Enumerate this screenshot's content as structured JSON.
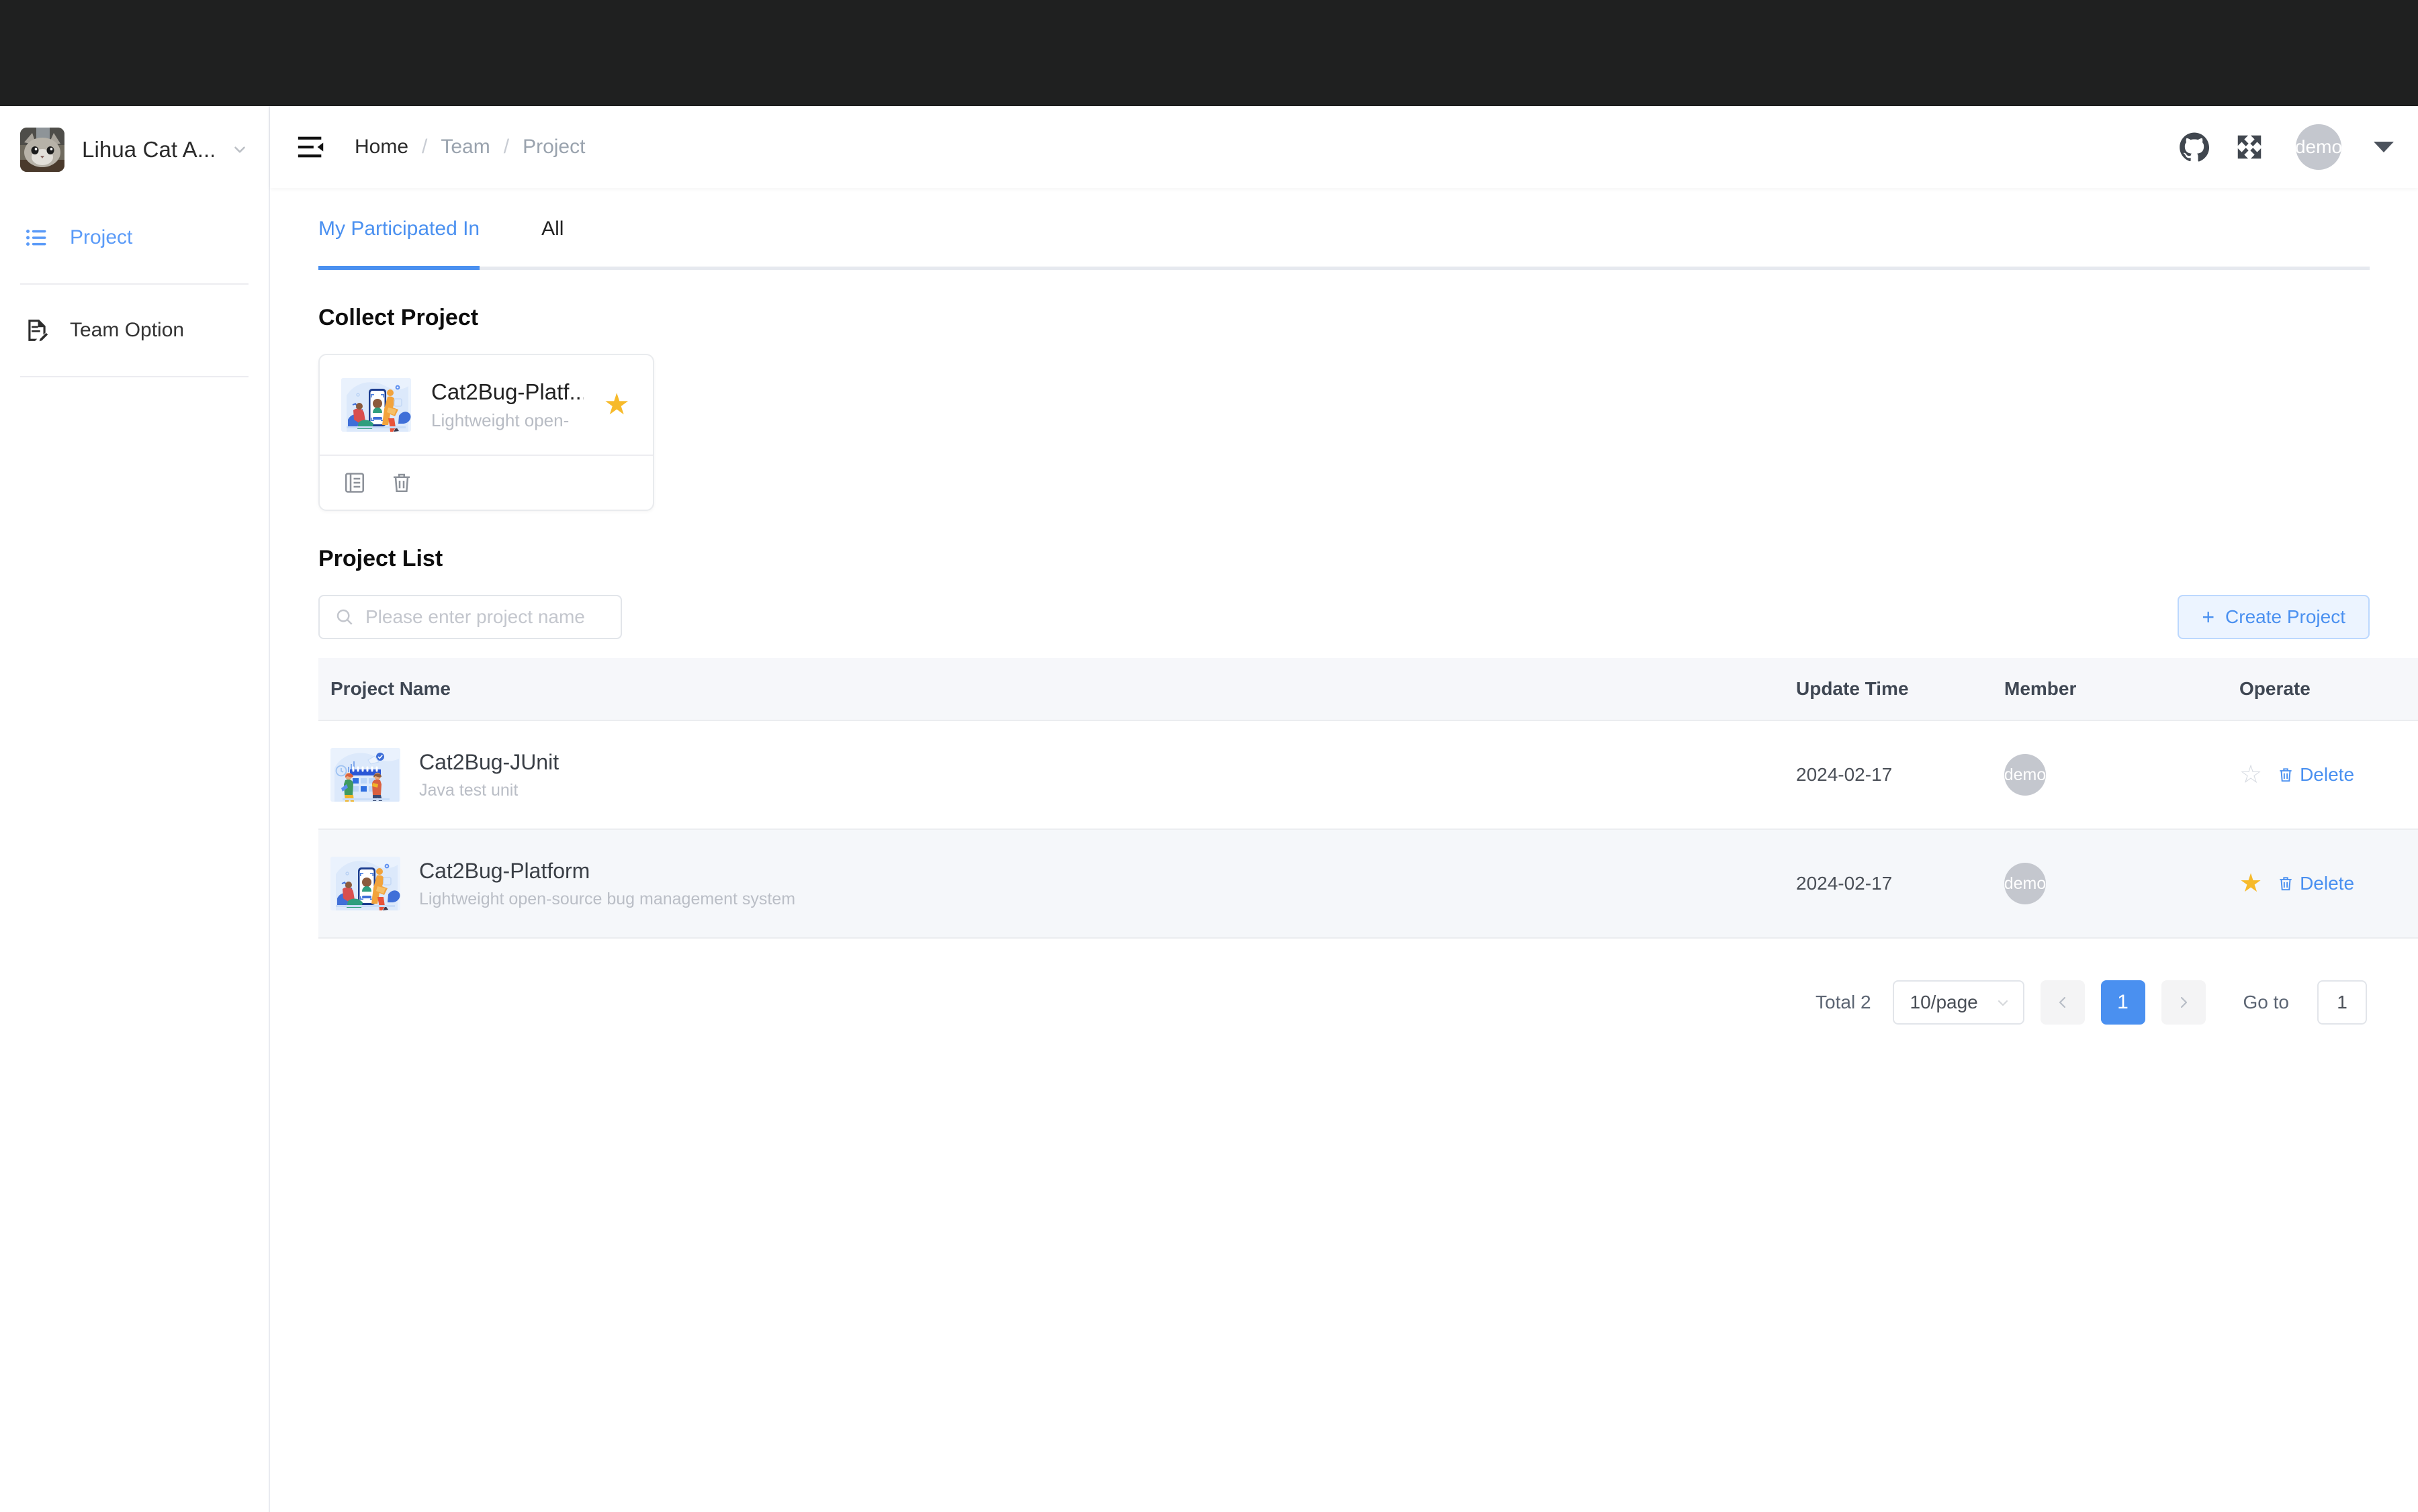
{
  "sidebar": {
    "team_name": "Lihua Cat A...",
    "avatar_alt": "cat-photo",
    "chevron_icon": "chevron-down-icon",
    "items": [
      {
        "label": "Project",
        "icon": "list-icon",
        "active": true
      },
      {
        "label": "Team Option",
        "icon": "document-edit-icon",
        "active": false
      }
    ]
  },
  "topbar": {
    "collapse_icon": "menu-collapse-icon",
    "breadcrumb": [
      {
        "label": "Home",
        "muted": false
      },
      {
        "label": "Team",
        "muted": true
      },
      {
        "label": "Project",
        "muted": true
      }
    ],
    "separator": "/",
    "github_icon": "github-icon",
    "fullscreen_icon": "fullscreen-icon",
    "avatar_text": "demo",
    "caret_icon": "caret-down-icon"
  },
  "tabs": [
    {
      "label": "My Participated In",
      "active": true
    },
    {
      "label": "All",
      "active": false
    }
  ],
  "collect": {
    "title": "Collect Project",
    "card": {
      "name": "Cat2Bug-Platf...",
      "desc": "Lightweight open-",
      "star_icon": "star-filled-icon",
      "thumb": "mobile-scan-illustration",
      "actions": [
        {
          "icon": "detail-icon",
          "name": "project-detail-action"
        },
        {
          "icon": "trash-icon",
          "name": "project-delete-action"
        }
      ]
    }
  },
  "list": {
    "title": "Project List",
    "search": {
      "placeholder": "Please enter project name",
      "value": "",
      "icon": "search-icon"
    },
    "create_button": {
      "label": "Create Project",
      "icon": "plus-icon"
    },
    "columns": [
      "Project Name",
      "Update Time",
      "Member",
      "Operate"
    ],
    "rows": [
      {
        "name": "Cat2Bug-JUnit",
        "desc": "Java test unit",
        "thumb": "calendar-illustration",
        "update_time": "2024-02-17",
        "member": "demo",
        "starred": false,
        "star_icon": "star-outline-icon",
        "delete_label": "Delete",
        "delete_icon": "trash-icon",
        "highlighted": false
      },
      {
        "name": "Cat2Bug-Platform",
        "desc": "Lightweight open-source bug management system",
        "thumb": "mobile-scan-illustration",
        "update_time": "2024-02-17",
        "member": "demo",
        "starred": true,
        "star_icon": "star-filled-icon",
        "delete_label": "Delete",
        "delete_icon": "trash-icon",
        "highlighted": true
      }
    ]
  },
  "pagination": {
    "total_label": "Total 2",
    "page_size": "10/page",
    "prev_icon": "chevron-left-icon",
    "next_icon": "chevron-right-icon",
    "pages": [
      "1"
    ],
    "current_page": "1",
    "goto_label": "Go to",
    "goto_value": "1"
  },
  "colors": {
    "accent": "#4a90f0",
    "star": "#f7ba2a",
    "chrome": "#1f2020",
    "muted": "#9aa3ae",
    "row_highlight": "#f5f7fa"
  }
}
